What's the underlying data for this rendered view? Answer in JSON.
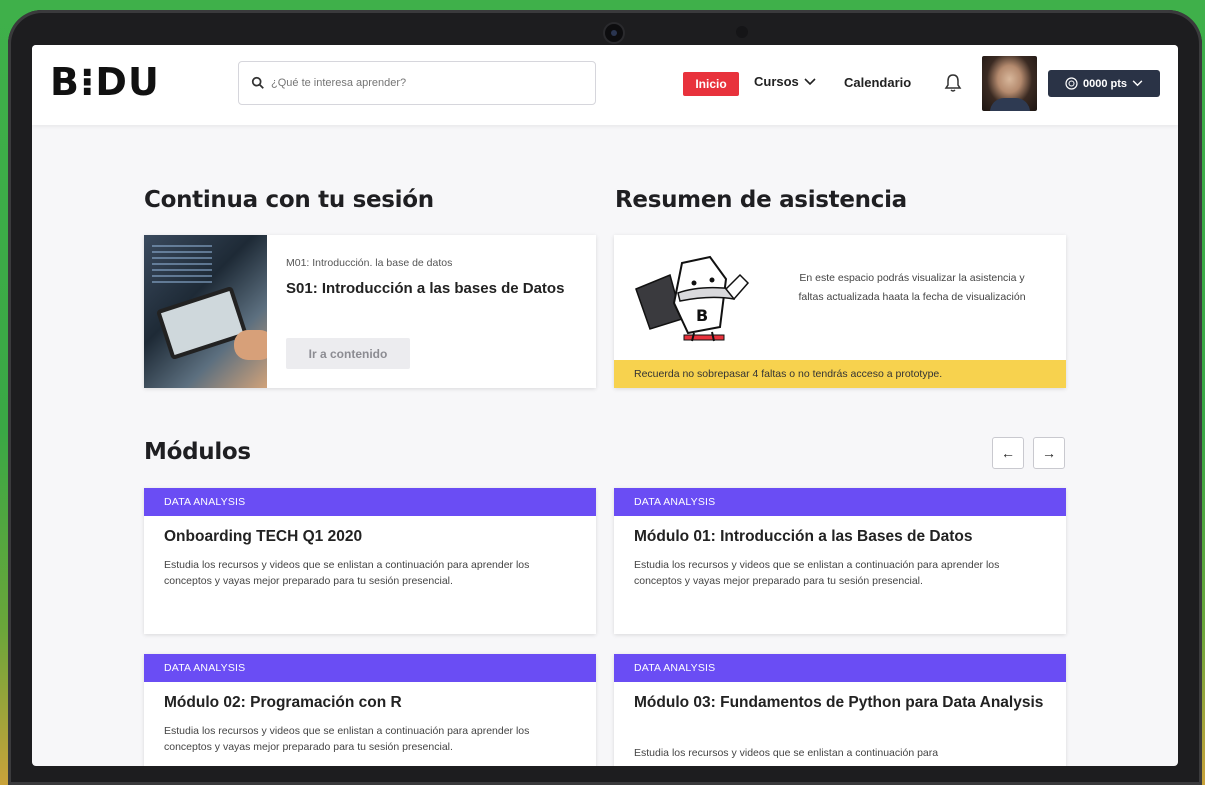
{
  "header": {
    "logo": "B⁝DU",
    "search_placeholder": "¿Qué te interesa aprender?",
    "nav": {
      "inicio": "Inicio",
      "cursos": "Cursos",
      "calendario": "Calendario"
    },
    "points": "0000 pts"
  },
  "session": {
    "heading": "Continua con tu sesión",
    "module_crumb": "M01: Introducción. la base de datos",
    "title": "S01: Introducción a las bases de Datos",
    "button": "Ir a contenido"
  },
  "attendance": {
    "heading": "Resumen de asistencia",
    "text": "En este espacio podrás visualizar la asistencia y faltas actualizada haata la fecha de visualización",
    "warning": "Recuerda no sobrepasar 4 faltas o no tendrás acceso a prototype."
  },
  "modules": {
    "heading": "Módulos",
    "prev": "←",
    "next": "→",
    "items": [
      {
        "category": "DATA ANALYSIS",
        "title": "Onboarding TECH Q1 2020",
        "description": "Estudia los recursos y videos que se enlistan a continuación para aprender los conceptos y vayas mejor preparado para tu sesión presencial."
      },
      {
        "category": "DATA ANALYSIS",
        "title": "Módulo 01: Introducción a las Bases de Datos",
        "description": "Estudia los recursos y videos que se enlistan a continuación para aprender los conceptos y vayas mejor preparado para tu sesión presencial."
      },
      {
        "category": "DATA ANALYSIS",
        "title": "Módulo 02: Programación con R",
        "description": "Estudia los recursos y videos que se enlistan a continuación para aprender los conceptos y vayas mejor preparado para tu sesión presencial."
      },
      {
        "category": "DATA ANALYSIS",
        "title": "Módulo 03: Fundamentos de Python para Data Analysis",
        "description": "Estudia los recursos y videos que se enlistan a continuación para"
      }
    ]
  },
  "colors": {
    "accent_red": "#e8323c",
    "module_purple": "#6a4df4",
    "warning_yellow": "#f7d24e",
    "points_bg": "#2a3346"
  }
}
